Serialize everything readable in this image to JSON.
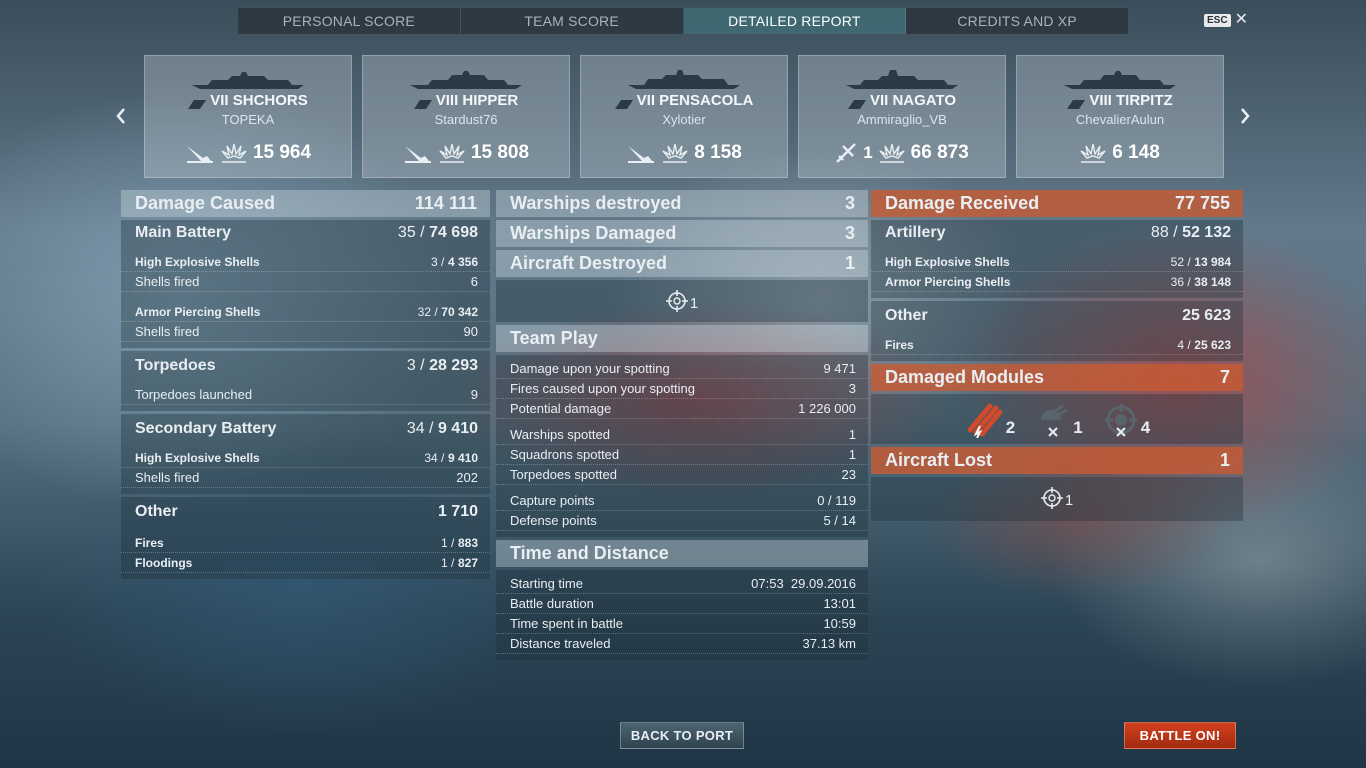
{
  "tabs": [
    "PERSONAL SCORE",
    "TEAM SCORE",
    "DETAILED REPORT",
    "CREDITS AND XP"
  ],
  "esc": {
    "key": "ESC"
  },
  "ships": [
    {
      "name": "VII SHCHORS",
      "player": "TOPEKA",
      "icon": "torpedo-hit-icon",
      "damage": "15 964",
      "extra": ""
    },
    {
      "name": "VIII HIPPER",
      "player": "Stardust76",
      "icon": "torpedo-hit-icon",
      "damage": "15 808",
      "extra": ""
    },
    {
      "name": "VII PENSACOLA",
      "player": "Xylotier",
      "icon": "torpedo-hit-icon",
      "damage": "8 158",
      "extra": ""
    },
    {
      "name": "VII NAGATO",
      "player": "Ammiraglio_VB",
      "icon": "plane-shot-icon",
      "damage": "66 873",
      "extra": "1"
    },
    {
      "name": "VIII TIRPITZ",
      "player": "ChevalierAulun",
      "icon": "",
      "damage": "6 148",
      "extra": ""
    }
  ],
  "left": {
    "damage_caused": {
      "label": "Damage Caused",
      "value": "114 111"
    },
    "main_battery": {
      "label": "Main Battery",
      "hits": "35 /",
      "value": "74 698"
    },
    "he": {
      "label": "High Explosive Shells",
      "hits": "3 /",
      "value": "4 356"
    },
    "he_fired": {
      "label": "Shells fired",
      "value": "6"
    },
    "ap": {
      "label": "Armor Piercing Shells",
      "hits": "32 /",
      "value": "70 342"
    },
    "ap_fired": {
      "label": "Shells fired",
      "value": "90"
    },
    "torpedoes": {
      "label": "Torpedoes",
      "hits": "3 /",
      "value": "28 293"
    },
    "torp_launched": {
      "label": "Torpedoes launched",
      "value": "9"
    },
    "secondary": {
      "label": "Secondary Battery",
      "hits": "34 /",
      "value": "9 410"
    },
    "sec_he": {
      "label": "High Explosive Shells",
      "hits": "34 /",
      "value": "9 410"
    },
    "sec_fired": {
      "label": "Shells fired",
      "value": "202"
    },
    "other": {
      "label": "Other",
      "value": "1 710"
    },
    "fires": {
      "label": "Fires",
      "hits": "1 /",
      "value": "883"
    },
    "floodings": {
      "label": "Floodings",
      "hits": "1 /",
      "value": "827"
    }
  },
  "middle": {
    "warships_destroyed": {
      "label": "Warships destroyed",
      "value": "3"
    },
    "warships_damaged": {
      "label": "Warships Damaged",
      "value": "3"
    },
    "aircraft_destroyed": {
      "label": "Aircraft Destroyed",
      "value": "1",
      "icon_value": "1"
    },
    "team_play": {
      "label": "Team Play"
    },
    "team_rows": [
      {
        "label": "Damage upon your spotting",
        "value": "9 471"
      },
      {
        "label": "Fires caused upon your spotting",
        "value": "3"
      },
      {
        "label": "Potential damage",
        "value": "1 226 000"
      },
      {
        "label": "Warships spotted",
        "value": "1"
      },
      {
        "label": "Squadrons spotted",
        "value": "1"
      },
      {
        "label": "Torpedoes spotted",
        "value": "23"
      },
      {
        "label": "Capture points",
        "value": "0 / 119"
      },
      {
        "label": "Defense points",
        "value": "5 / 14"
      }
    ],
    "time_distance": {
      "label": "Time and Distance"
    },
    "time_rows": [
      {
        "label": "Starting time",
        "value": "07:53  29.09.2016"
      },
      {
        "label": "Battle duration",
        "value": "13:01"
      },
      {
        "label": "Time spent in battle",
        "value": "10:59"
      },
      {
        "label": "Distance traveled",
        "value": "37.13 km"
      }
    ]
  },
  "right": {
    "damage_received": {
      "label": "Damage Received",
      "value": "77 755"
    },
    "artillery": {
      "label": "Artillery",
      "hits": "88 /",
      "value": "52 132"
    },
    "he": {
      "label": "High Explosive Shells",
      "hits": "52 /",
      "value": "13 984"
    },
    "ap": {
      "label": "Armor Piercing Shells",
      "hits": "36 /",
      "value": "38 148"
    },
    "other": {
      "label": "Other",
      "value": "25 623"
    },
    "fires": {
      "label": "Fires",
      "hits": "4 /",
      "value": "25 623"
    },
    "modules": {
      "label": "Damaged Modules",
      "value": "7",
      "items": [
        {
          "icon": "torpedo-tubes-damaged-icon",
          "count": "2"
        },
        {
          "icon": "aa-gun-destroyed-icon",
          "count": "1"
        },
        {
          "icon": "secondary-gun-destroyed-icon",
          "count": "4"
        }
      ]
    },
    "aircraft_lost": {
      "label": "Aircraft Lost",
      "value": "1",
      "icon_value": "1"
    }
  },
  "buttons": {
    "back": "BACK TO PORT",
    "battle": "BATTLE ON!"
  },
  "colors": {
    "accent_orange": "#c85a32",
    "battle_button": "#c63a19",
    "active_tab": "#46788a"
  }
}
